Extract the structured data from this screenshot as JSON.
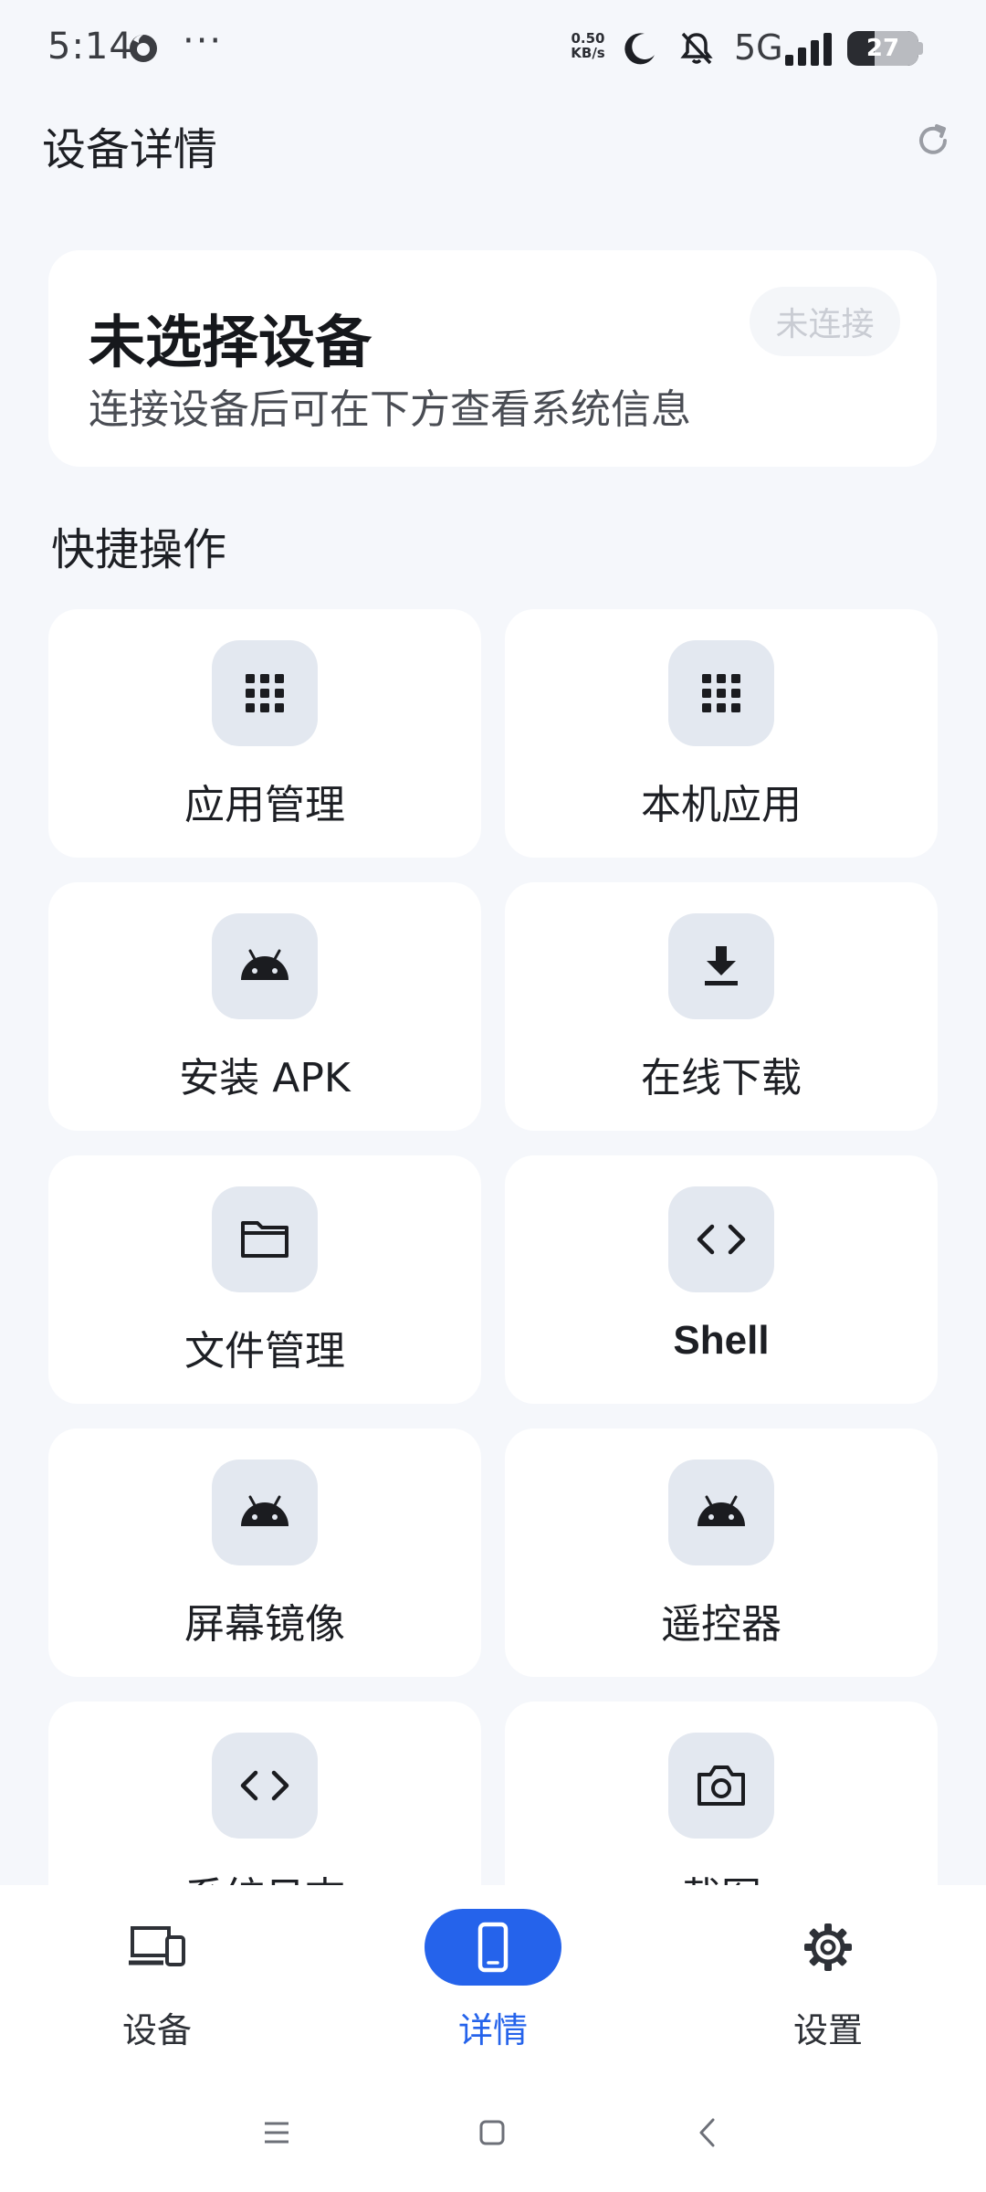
{
  "status_bar": {
    "time": "5:14",
    "dots": "···",
    "net_speed_value": "0.50",
    "net_speed_unit": "KB/s",
    "network": "5G",
    "battery_level": "27"
  },
  "app_bar": {
    "title": "设备详情",
    "refresh_icon": "refresh-icon"
  },
  "device_card": {
    "title": "未选择设备",
    "subtitle": "连接设备后可在下方查看系统信息",
    "status": "未连接"
  },
  "quick_actions": {
    "title": "快捷操作",
    "items": [
      {
        "label": "应用管理",
        "icon": "apps-grid-icon"
      },
      {
        "label": "本机应用",
        "icon": "apps-grid-icon"
      },
      {
        "label": "安装 APK",
        "icon": "android-icon"
      },
      {
        "label": "在线下载",
        "icon": "download-icon"
      },
      {
        "label": "文件管理",
        "icon": "folder-icon"
      },
      {
        "label": "Shell",
        "icon": "code-icon"
      },
      {
        "label": "屏幕镜像",
        "icon": "android-icon"
      },
      {
        "label": "遥控器",
        "icon": "android-icon"
      },
      {
        "label": "系统日志",
        "icon": "code-icon"
      },
      {
        "label": "截图",
        "icon": "camera-icon"
      }
    ]
  },
  "bottom_nav": {
    "items": [
      {
        "label": "设备",
        "icon": "devices-icon",
        "active": false
      },
      {
        "label": "详情",
        "icon": "phone-icon",
        "active": true
      },
      {
        "label": "设置",
        "icon": "gear-icon",
        "active": false
      }
    ]
  },
  "colors": {
    "background": "#f5f7fb",
    "card": "#ffffff",
    "icon_tile": "#e3e8f0",
    "accent": "#2563eb",
    "badge_text": "#c9ccd3"
  }
}
